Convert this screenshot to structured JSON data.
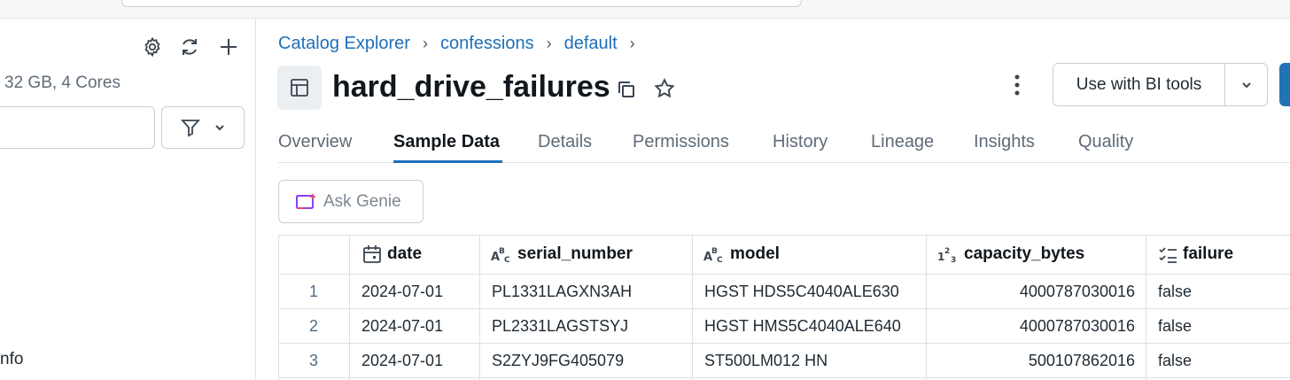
{
  "left_pane": {
    "compute_info": "32 GB, 4 Cores",
    "info_text": "nfo"
  },
  "breadcrumb": [
    "Catalog Explorer",
    "confessions",
    "default"
  ],
  "header": {
    "title": "hard_drive_failures",
    "bi_button_label": "Use with BI tools"
  },
  "tabs": [
    "Overview",
    "Sample Data",
    "Details",
    "Permissions",
    "History",
    "Lineage",
    "Insights",
    "Quality"
  ],
  "active_tab": "Sample Data",
  "genie_button_label": "Ask Genie",
  "table": {
    "columns": [
      {
        "name": "date",
        "type_icon": "calendar-icon"
      },
      {
        "name": "serial_number",
        "type_icon": "string-type-icon"
      },
      {
        "name": "model",
        "type_icon": "string-type-icon"
      },
      {
        "name": "capacity_bytes",
        "type_icon": "number-type-icon"
      },
      {
        "name": "failure",
        "type_icon": "boolean-type-icon"
      }
    ],
    "rows": [
      {
        "index": "1",
        "date": "2024-07-01",
        "serial_number": "PL1331LAGXN3AH",
        "model": "HGST HDS5C4040ALE630",
        "capacity_bytes": "4000787030016",
        "failure": "false"
      },
      {
        "index": "2",
        "date": "2024-07-01",
        "serial_number": "PL2331LAGSTSYJ",
        "model": "HGST HMS5C4040ALE640",
        "capacity_bytes": "4000787030016",
        "failure": "false"
      },
      {
        "index": "3",
        "date": "2024-07-01",
        "serial_number": "S2ZYJ9FG405079",
        "model": "ST500LM012 HN",
        "capacity_bytes": "500107862016",
        "failure": "false"
      }
    ]
  },
  "colors": {
    "link": "#1f6fb8",
    "active_tab_underline": "#1f6fb8",
    "primary_button": "#2272b4"
  }
}
